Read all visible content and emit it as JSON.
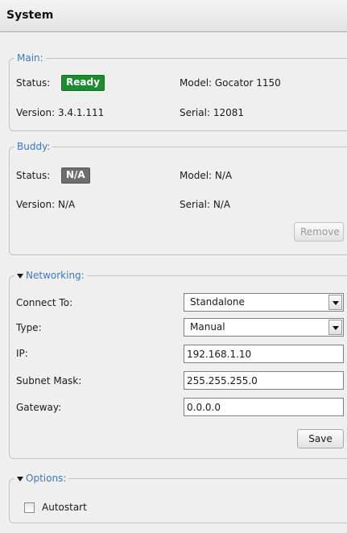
{
  "header": {
    "title": "System"
  },
  "main": {
    "legend": "Main:",
    "status_label": "Status:",
    "status_value": "Ready",
    "model": "Model: Gocator 1150",
    "version": "Version: 3.4.1.111",
    "serial": "Serial: 12081"
  },
  "buddy": {
    "legend": "Buddy:",
    "status_label": "Status:",
    "status_value": "N/A",
    "model": "Model: N/A",
    "version": "Version: N/A",
    "serial": "Serial: N/A",
    "remove_label": "Remove"
  },
  "networking": {
    "legend": "Networking:",
    "connect_label": "Connect To:",
    "connect_value": "Standalone",
    "type_label": "Type:",
    "type_value": "Manual",
    "ip_label": "IP:",
    "ip_value": "192.168.1.10",
    "subnet_label": "Subnet Mask:",
    "subnet_value": "255.255.255.0",
    "gateway_label": "Gateway:",
    "gateway_value": "0.0.0.0",
    "save_label": "Save"
  },
  "options": {
    "legend": "Options:",
    "autostart_label": "Autostart",
    "autostart_checked": false
  },
  "colors": {
    "ready_badge": "#1b8f2f",
    "na_badge": "#6e6e6e",
    "legend_text": "#3c78c8"
  }
}
